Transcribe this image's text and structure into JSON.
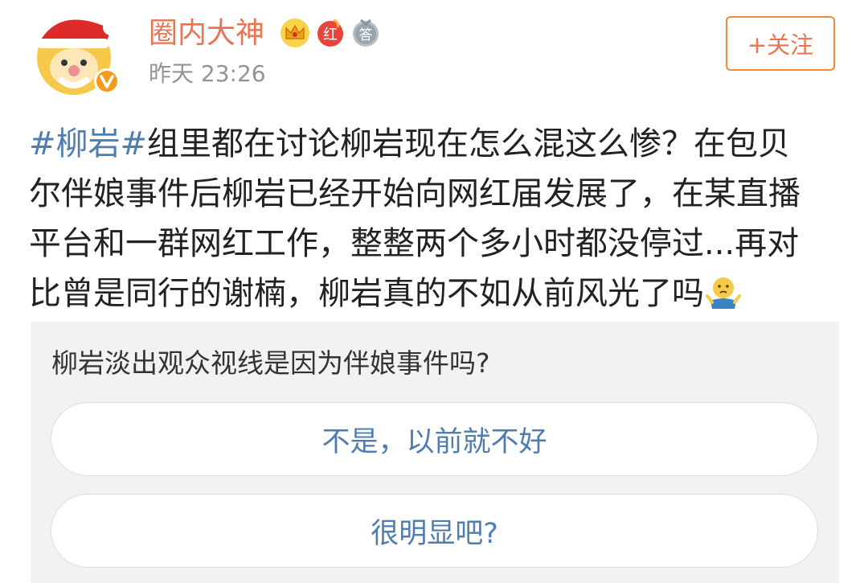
{
  "user": {
    "name": "圈内大神",
    "time": "昨天 23:26",
    "avatar_icon": "santa-mascot-avatar",
    "verified_icon": "orange-v-verified-badge",
    "badges": [
      {
        "icon": "crown-icon",
        "text": ""
      },
      {
        "icon": "red-badge-icon",
        "text": "红"
      },
      {
        "icon": "answer-badge-icon",
        "text": "答"
      }
    ]
  },
  "follow_button": {
    "label": "+关注"
  },
  "post": {
    "hashtag": "#柳岩#",
    "lines": [
      "组里都在讨论柳岩现在怎么混这么惨？在包贝",
      "尔伴娘事件后柳岩已经开始向网红届发展了，在某直播",
      "平台和一群网红工作，整整两个多小时都没停过...再对",
      "比曾是同行的谢楠，柳岩真的不如从前风光了吗"
    ],
    "emoji": "shrug-emoji"
  },
  "poll": {
    "question": "柳岩淡出观众视线是因为伴娘事件吗?",
    "options": [
      {
        "label": "不是，以前就不好"
      },
      {
        "label": "很明显吧?"
      }
    ]
  },
  "colors": {
    "username": "#eb7350",
    "link": "#507daf",
    "follow_border": "#f08a3a",
    "time": "#939393",
    "poll_bg": "#f2f2f2"
  }
}
